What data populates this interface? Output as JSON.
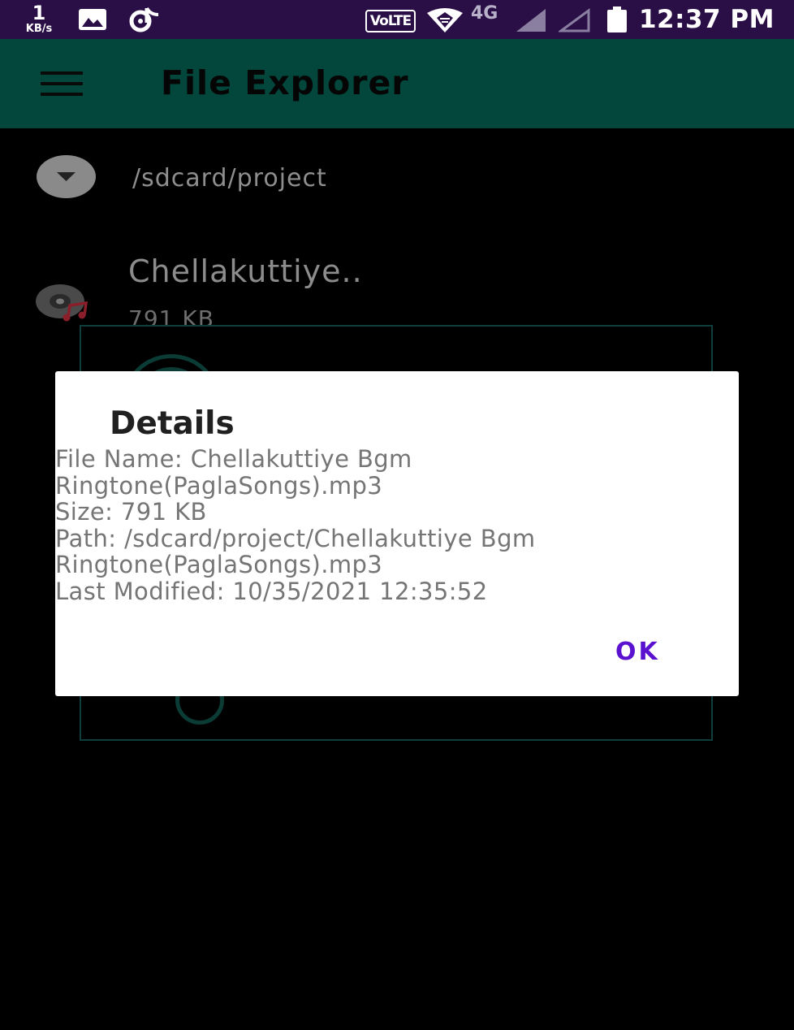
{
  "status_bar": {
    "net_speed_value": "1",
    "net_speed_unit": "KB/s",
    "volte_label": "VoLTE",
    "network_type": "4G",
    "time": "12:37 PM",
    "icons": [
      "image-icon",
      "tiktok-icon",
      "hotspot-icon",
      "signal-1-icon",
      "signal-2-icon",
      "battery-icon"
    ]
  },
  "app_bar": {
    "title": "File Explorer",
    "menu_icon": "menu-icon",
    "color": "#02463c"
  },
  "file_list": {
    "current_path": "/sdcard/project",
    "items": [
      {
        "name": "Chellakuttiye..",
        "size": "791 KB",
        "icon": "music-disc-icon"
      }
    ]
  },
  "dialog": {
    "title": "Details",
    "lines": [
      "File Name: Chellakuttiye Bgm",
      "Ringtone(PaglaSongs).mp3",
      "Size: 791 KB",
      "Path: /sdcard/project/Chellakuttiye Bgm",
      "Ringtone(PaglaSongs).mp3",
      "Last Modified: 10/35/2021 12:35:52"
    ],
    "ok_label": "OK",
    "accent_color": "#5a12d0"
  }
}
